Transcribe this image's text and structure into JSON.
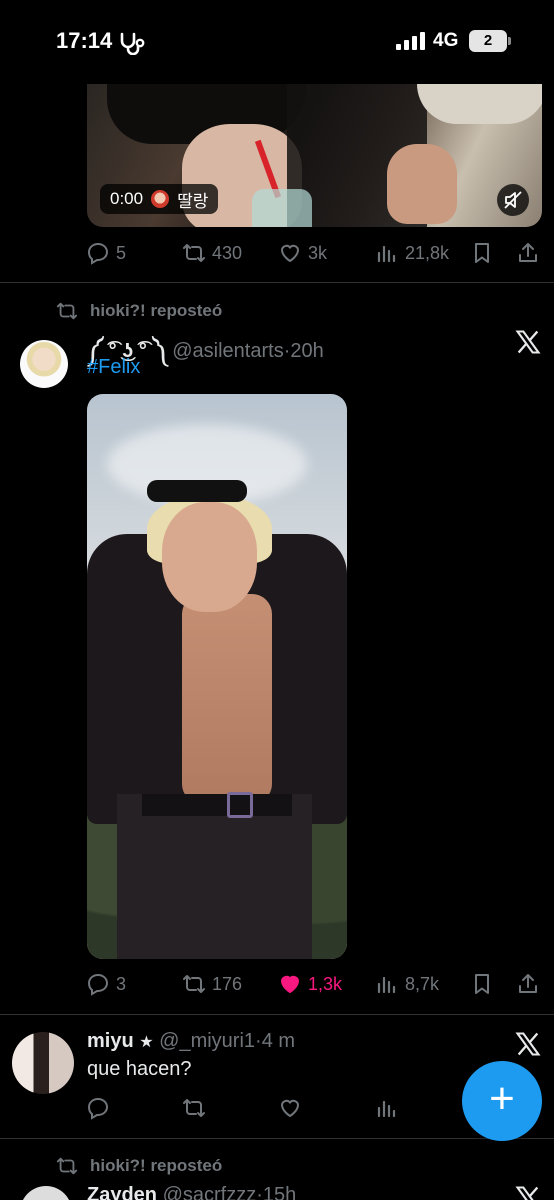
{
  "status_bar": {
    "time": "17:14",
    "network": "4G",
    "battery": "2"
  },
  "tweet1": {
    "video_time": "0:00",
    "video_caption": "딸랑",
    "replies": "5",
    "reposts": "430",
    "likes": "3k",
    "views": "21,8k"
  },
  "repost_banner_1": "hioki?! reposteó",
  "tweet2": {
    "display_name": "༼ ͡° ͜ʖ ͡° ༽",
    "handle": "@asilentarts",
    "time": "20h",
    "hashtag": "#Felix",
    "replies": "3",
    "reposts": "176",
    "likes": "1,3k",
    "views": "8,7k",
    "liked": true
  },
  "tweet3": {
    "display_name": "miyu",
    "badge": "★",
    "handle": "@_miyuri1",
    "time": "4 m",
    "text": "que hacen?"
  },
  "repost_banner_2": "hioki?! reposteó",
  "tweet4": {
    "display_name": "Zayden",
    "handle": "@sacrfzzz",
    "time": "15h"
  },
  "colors": {
    "accent": "#1d9bf0",
    "like": "#f91880",
    "muted": "#71767b",
    "background": "#000000"
  }
}
